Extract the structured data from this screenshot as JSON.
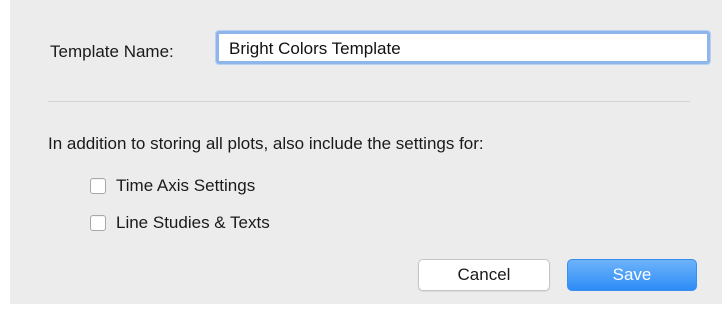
{
  "dialog": {
    "template_name_label": "Template Name:",
    "template_name_value": "Bright Colors Template",
    "instructions": "In addition to storing all plots, also include the settings for:",
    "options": [
      {
        "label": "Time Axis Settings",
        "checked": false
      },
      {
        "label": "Line Studies & Texts",
        "checked": false
      }
    ],
    "buttons": {
      "cancel_label": "Cancel",
      "save_label": "Save"
    }
  },
  "colors": {
    "dialog_background": "#ececec",
    "focus_ring": "#8fb6ea",
    "primary_button": "#2d8cf5"
  }
}
